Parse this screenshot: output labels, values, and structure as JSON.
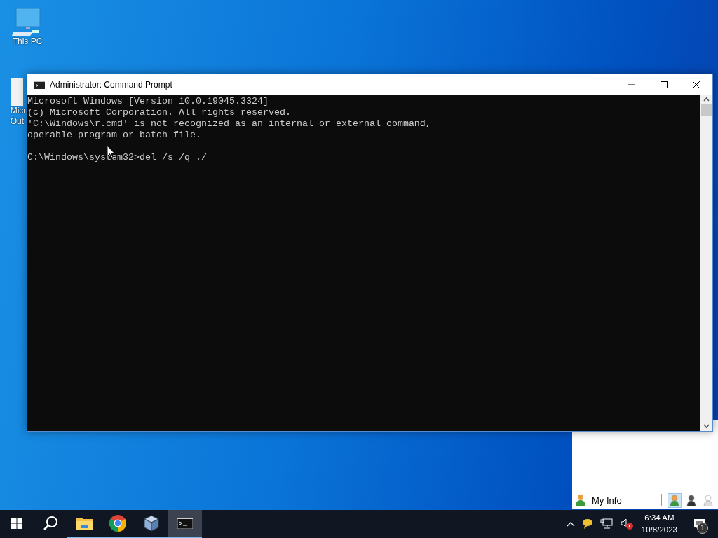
{
  "desktop": {
    "icons": [
      {
        "kind": "pc",
        "lines": [
          "This PC"
        ]
      },
      {
        "kind": "document",
        "lines": [
          "Micr",
          "Out"
        ]
      }
    ]
  },
  "window": {
    "title": "Administrator: Command Prompt",
    "console": {
      "output": [
        "Microsoft Windows [Version 10.0.19045.3324]",
        "(c) Microsoft Corporation. All rights reserved.",
        "'C:\\Windows\\r.cmd' is not recognized as an internal or external command,",
        "operable program or batch file."
      ],
      "prompt": "C:\\Windows\\system32>del /s /q ./"
    }
  },
  "side_panel": {
    "my_info": "My Info",
    "statuses": [
      {
        "kind": "green",
        "selected": true
      },
      {
        "kind": "dark",
        "selected": false
      },
      {
        "kind": "light",
        "selected": false
      }
    ]
  },
  "taskbar": {
    "items": [
      {
        "kind": "start",
        "running": false,
        "selected": false
      },
      {
        "kind": "search",
        "running": false,
        "selected": false
      },
      {
        "kind": "explorer",
        "running": true,
        "selected": false
      },
      {
        "kind": "chrome",
        "running": true,
        "selected": false
      },
      {
        "kind": "virtualbox",
        "running": true,
        "selected": false
      },
      {
        "kind": "cmd",
        "running": true,
        "selected": true
      }
    ],
    "tray": {
      "time": "6:34 AM",
      "date": "10/8/2023",
      "notifications": "1"
    }
  }
}
